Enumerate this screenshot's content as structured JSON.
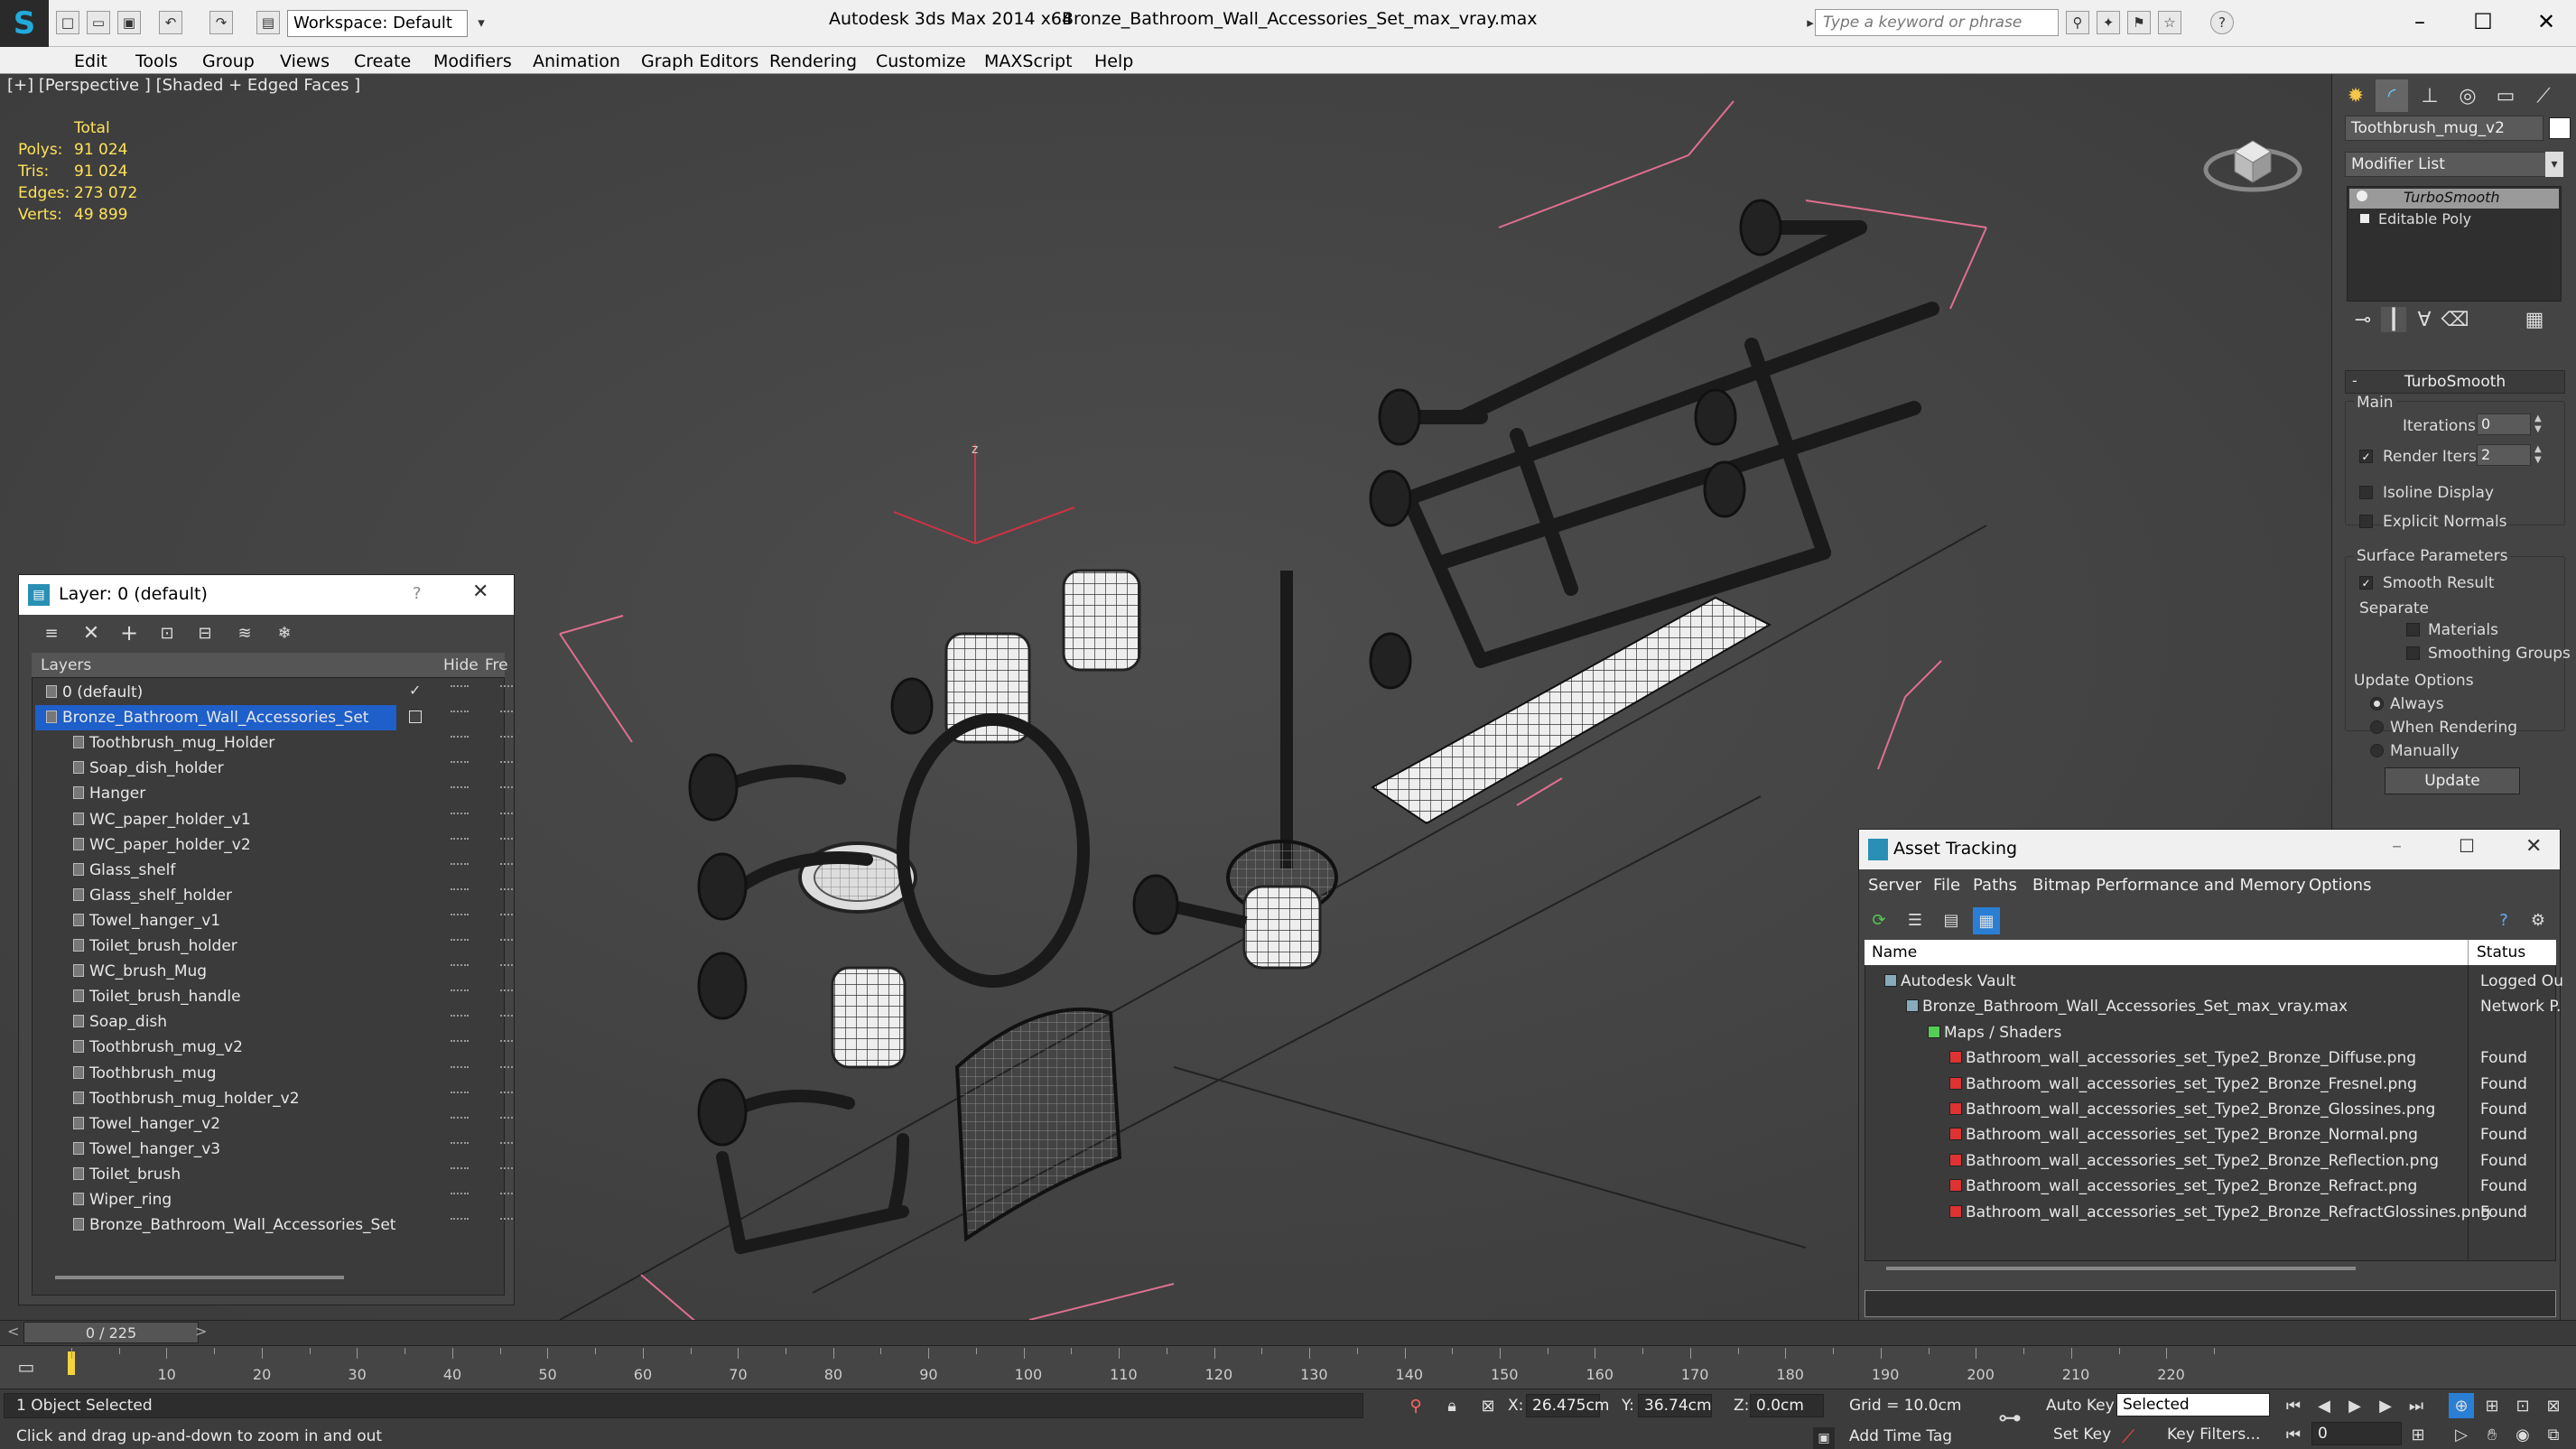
{
  "titlebar": {
    "workspace": "Workspace: Default",
    "app": "Autodesk 3ds Max  2014 x64",
    "file": "Bronze_Bathroom_Wall_Accessories_Set_max_vray.max",
    "search_placeholder": "Type a keyword or phrase"
  },
  "menus": [
    "Edit",
    "Tools",
    "Group",
    "Views",
    "Create",
    "Modifiers",
    "Animation",
    "Graph Editors",
    "Rendering",
    "Customize",
    "MAXScript",
    "Help"
  ],
  "viewport": {
    "label": "[+] [Perspective ] [Shaded + Edged Faces ]",
    "stats_header": "Total",
    "stats": [
      {
        "k": "Polys:",
        "v": "91 024"
      },
      {
        "k": "Tris:",
        "v": "91 024"
      },
      {
        "k": "Edges:",
        "v": "273 072"
      },
      {
        "k": "Verts:",
        "v": "49 899"
      }
    ],
    "axis_z": "z"
  },
  "command_panel": {
    "object_name": "Toothbrush_mug_v2",
    "modifier_list": "Modifier List",
    "stack": [
      "TurboSmooth",
      "Editable Poly"
    ],
    "rollout": "TurboSmooth",
    "main": "Main",
    "iterations_label": "Iterations:",
    "iterations": "0",
    "render_iters_label": "Render Iters:",
    "render_iters": "2",
    "isoline": "Isoline Display",
    "explicit": "Explicit Normals",
    "surface": "Surface Parameters",
    "smooth": "Smooth Result",
    "separate": "Separate",
    "materials": "Materials",
    "smoothing_groups": "Smoothing Groups",
    "update_options": "Update Options",
    "always": "Always",
    "when_rendering": "When Rendering",
    "manually": "Manually",
    "update": "Update"
  },
  "layer_dialog": {
    "title": "Layer: 0 (default)",
    "col_layers": "Layers",
    "col_hide": "Hide",
    "col_freeze": "Fre",
    "layers": [
      {
        "name": "0 (default)"
      },
      {
        "name": "Bronze_Bathroom_Wall_Accessories_Set"
      }
    ],
    "objects": [
      "Toothbrush_mug_Holder",
      "Soap_dish_holder",
      "Hanger",
      "WC_paper_holder_v1",
      "WC_paper_holder_v2",
      "Glass_shelf",
      "Glass_shelf_holder",
      "Towel_hanger_v1",
      "Toilet_brush_holder",
      "WC_brush_Mug",
      "Toilet_brush_handle",
      "Soap_dish",
      "Toothbrush_mug_v2",
      "Toothbrush_mug",
      "Toothbrush_mug_holder_v2",
      "Towel_hanger_v2",
      "Towel_hanger_v3",
      "Toilet_brush",
      "Wiper_ring",
      "Bronze_Bathroom_Wall_Accessories_Set"
    ]
  },
  "asset_dialog": {
    "title": "Asset Tracking",
    "menus": [
      "Server",
      "File",
      "Paths",
      "Bitmap Performance and Memory",
      "Options"
    ],
    "col_name": "Name",
    "col_status": "Status",
    "rows": [
      {
        "name": "Autodesk Vault",
        "status": "Logged Ou",
        "indent": 1
      },
      {
        "name": "Bronze_Bathroom_Wall_Accessories_Set_max_vray.max",
        "status": "Network P.",
        "indent": 2
      },
      {
        "name": "Maps / Shaders",
        "status": "",
        "indent": 3
      },
      {
        "name": "Bathroom_wall_accessories_set_Type2_Bronze_Diffuse.png",
        "status": "Found",
        "indent": 4
      },
      {
        "name": "Bathroom_wall_accessories_set_Type2_Bronze_Fresnel.png",
        "status": "Found",
        "indent": 4
      },
      {
        "name": "Bathroom_wall_accessories_set_Type2_Bronze_Glossines.png",
        "status": "Found",
        "indent": 4
      },
      {
        "name": "Bathroom_wall_accessories_set_Type2_Bronze_Normal.png",
        "status": "Found",
        "indent": 4
      },
      {
        "name": "Bathroom_wall_accessories_set_Type2_Bronze_Reflection.png",
        "status": "Found",
        "indent": 4
      },
      {
        "name": "Bathroom_wall_accessories_set_Type2_Bronze_Refract.png",
        "status": "Found",
        "indent": 4
      },
      {
        "name": "Bathroom_wall_accessories_set_Type2_Bronze_RefractGlossines.png",
        "status": "Found",
        "indent": 4
      }
    ]
  },
  "timeline": {
    "frame": "0 / 225",
    "ticks": [
      "10",
      "20",
      "30",
      "40",
      "50",
      "60",
      "70",
      "80",
      "90",
      "100",
      "110",
      "120",
      "130",
      "140",
      "150",
      "160",
      "170",
      "180",
      "190",
      "200",
      "210",
      "220"
    ]
  },
  "status": {
    "selected": "1 Object Selected",
    "hint": "Click and drag up-and-down to zoom in and out",
    "x_label": "X:",
    "x": "26.475cm",
    "y_label": "Y:",
    "y": "36.74cm",
    "z_label": "Z:",
    "z": "0.0cm",
    "grid": "Grid = 10.0cm",
    "add_time_tag": "Add Time Tag",
    "auto_key": "Auto Key",
    "selected_set": "Selected",
    "set_key": "Set Key",
    "key_filters": "Key Filters...",
    "frame_field": "0"
  }
}
